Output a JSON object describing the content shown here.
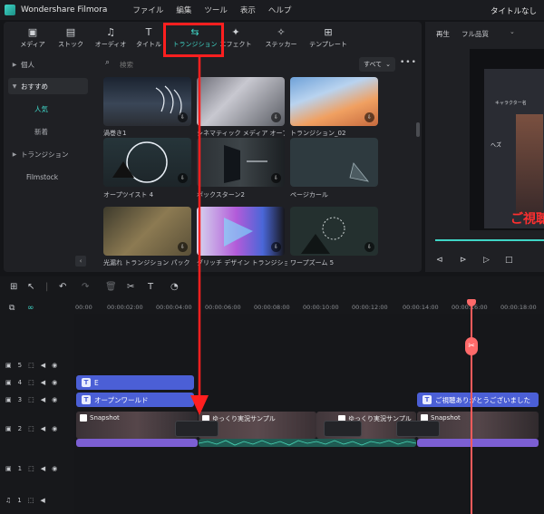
{
  "titlebar": {
    "app_name": "Wondershare Filmora",
    "menus": [
      "ファイル",
      "編集",
      "ツール",
      "表示",
      "ヘルプ"
    ],
    "project_title": "タイトルなし"
  },
  "toolbar": {
    "tabs": [
      {
        "label": "メディア",
        "icon": "media-icon"
      },
      {
        "label": "ストック",
        "icon": "stock-icon"
      },
      {
        "label": "オーディオ",
        "icon": "music-icon"
      },
      {
        "label": "タイトル",
        "icon": "title-icon"
      },
      {
        "label": "トランジション",
        "icon": "transition-icon"
      },
      {
        "label": "エフェクト",
        "icon": "effect-icon"
      },
      {
        "label": "ステッカー",
        "icon": "sticker-icon"
      },
      {
        "label": "テンプレート",
        "icon": "template-icon"
      }
    ],
    "active_index": 4
  },
  "sidebar": {
    "items": [
      "個人",
      "おすすめ",
      "トランジション",
      "Filmstock"
    ],
    "sub_items": [
      "人気",
      "新着"
    ]
  },
  "search": {
    "placeholder": "検索",
    "filter": "すべて"
  },
  "thumbnails": [
    "渦巻き1",
    "シネマティック メディア オープナー ...",
    "トランジション_02",
    "オープツイスト 4",
    "ボックスターン2",
    "ページカール",
    "光漏れ トランジション パック トラ...",
    "グリッチ デザイン トランジション 04",
    "ワープズーム 5"
  ],
  "preview": {
    "play_label": "再生",
    "quality": "フル品質",
    "overlay_text": "ご視聴",
    "card_title": "キャラクター名",
    "card_name": "ヘズ"
  },
  "ruler": {
    "labels": [
      "00:00",
      "00:00:02:00",
      "00:00:04:00",
      "00:00:06:00",
      "00:00:08:00",
      "00:00:10:00",
      "00:00:12:00",
      "00:00:14:00",
      "00:00:16:00",
      "00:00:18:00"
    ]
  },
  "tracks": {
    "numbers": [
      "5",
      "4",
      "3",
      "2",
      "1",
      "1"
    ],
    "title_clip_4": "E",
    "title_clip_3a": "オープンワールド",
    "title_clip_3b": "ご視聴ありがとうございました",
    "video_clips": [
      "Snapshot",
      "ゆっくり実況サンプル",
      "ゆっくり実況サンプル",
      "Snapshot"
    ]
  },
  "colors": {
    "accent": "#3fd5c6",
    "title_clip": "#4b5fd6",
    "audio_clip": "#7c5fd3",
    "playhead": "#ff5b5b",
    "annotation": "#ff1f1f"
  }
}
